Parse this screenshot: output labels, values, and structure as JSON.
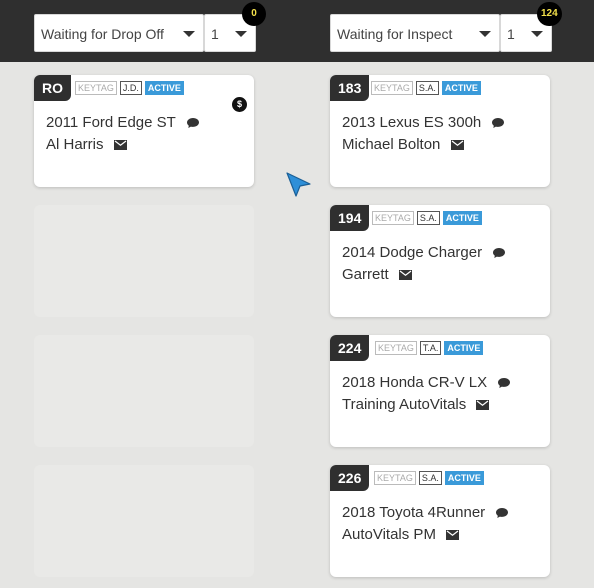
{
  "columns": [
    {
      "status_select": "Waiting for Drop Off",
      "page_select": "1",
      "count": "0"
    },
    {
      "status_select": "Waiting for Inspect",
      "page_select": "1",
      "count": "124"
    }
  ],
  "tag_keytag": "KEYTAG",
  "tag_active": "ACTIVE",
  "left_card": {
    "ro": "RO",
    "initials": "J.D.",
    "vehicle": "2011 Ford Edge ST",
    "customer": "Al Harris",
    "dollar": "$"
  },
  "right_cards": [
    {
      "ro": "183",
      "initials": "S.A.",
      "vehicle": "2013 Lexus ES 300h",
      "customer": "Michael Bolton"
    },
    {
      "ro": "194",
      "initials": "S.A.",
      "vehicle": "2014 Dodge Charger",
      "customer": "Garrett"
    },
    {
      "ro": "224",
      "initials": "T.A.",
      "vehicle": "2018 Honda CR-V LX",
      "customer": "Training AutoVitals"
    },
    {
      "ro": "226",
      "initials": "S.A.",
      "vehicle": "2018 Toyota 4Runner",
      "customer": "AutoVitals PM"
    }
  ],
  "colors": {
    "header": "#2f2f2f",
    "active_tag": "#3a9ad9",
    "badge_text": "#f3e04a",
    "background": "#e5e5e3"
  }
}
